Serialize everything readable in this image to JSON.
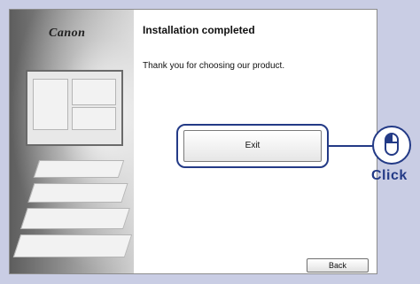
{
  "brand": {
    "logo_text": "Canon"
  },
  "header": {
    "title": "Installation completed"
  },
  "main": {
    "message": "Thank you for choosing our product."
  },
  "buttons": {
    "exit_label": "Exit",
    "back_label": "Back"
  },
  "callout": {
    "label": "Click",
    "icon": "mouse-icon"
  },
  "colors": {
    "accent": "#233a86",
    "background": "#c9cde4"
  }
}
